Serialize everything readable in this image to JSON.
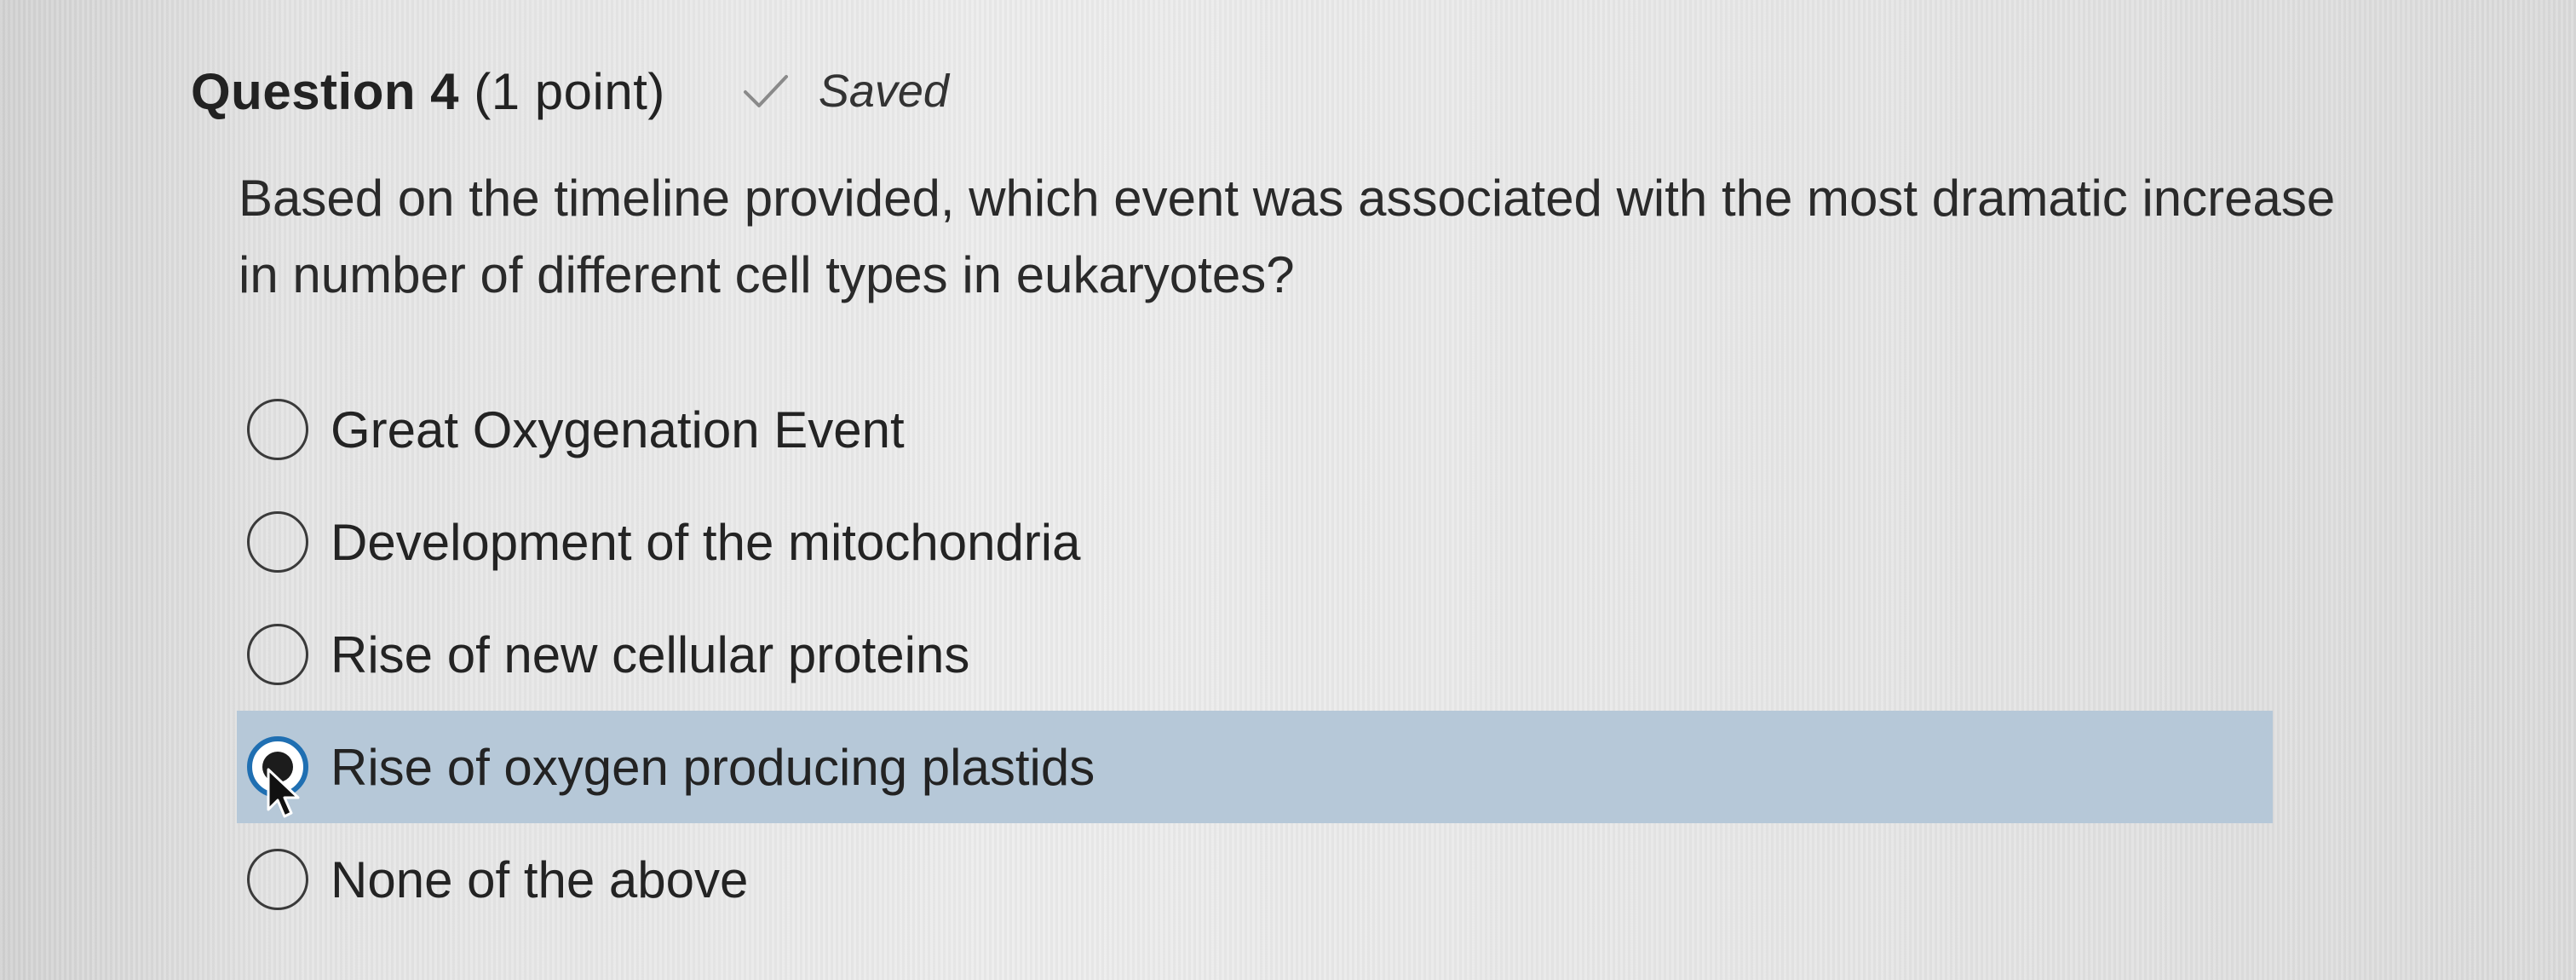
{
  "header": {
    "question_label": "Question 4",
    "points": "(1 point)",
    "status_text": "Saved",
    "status_icon": "checkmark-icon"
  },
  "question": {
    "text": "Based on the timeline provided, which event was associated with the most dramatic increase in number of different cell types in eukaryotes?"
  },
  "options": [
    {
      "label": "Great Oxygenation Event",
      "selected": false
    },
    {
      "label": "Development of the mitochondria",
      "selected": false
    },
    {
      "label": "Rise of new cellular proteins",
      "selected": false
    },
    {
      "label": "Rise of oxygen producing plastids",
      "selected": true
    },
    {
      "label": "None of the above",
      "selected": false
    }
  ],
  "colors": {
    "selected_row": "#b6c8d8",
    "radio_selected_ring": "#1f6fb2"
  }
}
